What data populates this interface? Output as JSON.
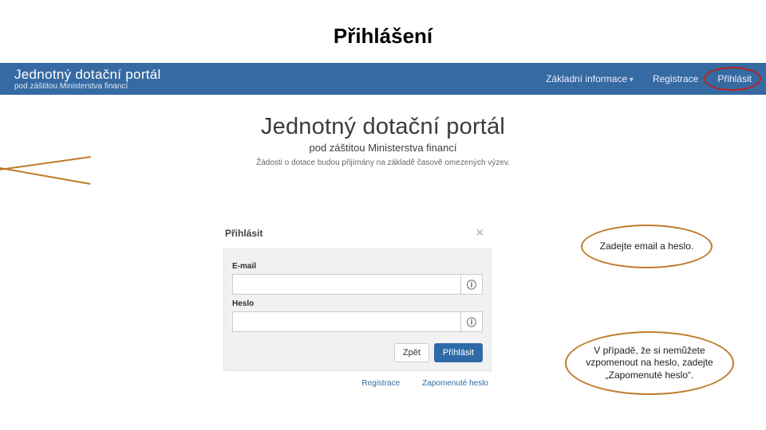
{
  "slide": {
    "title": "Přihlášení"
  },
  "nav": {
    "brand_main": "Jednotný dotační portál",
    "brand_sub": "pod záštitou Ministerstva financí",
    "item_info": "Základní informace",
    "item_register": "Registrace",
    "item_login": "Přihlásit"
  },
  "page_header": {
    "main": "Jednotný dotační portál",
    "sub": "pod záštitou Ministerstva financí",
    "sub2": "Žádosti o dotace budou přijímány na základě časově omezených výzev."
  },
  "modal": {
    "title": "Přihlásit",
    "label_email": "E-mail",
    "email_value": "",
    "label_password": "Heslo",
    "password_value": "",
    "btn_back": "Zpět",
    "btn_login": "Přihlásit",
    "link_register": "Registrace",
    "link_forgot": "Zapomenuté heslo",
    "info_glyph": "ⓘ"
  },
  "bubbles": {
    "b1": "Zadejte email a heslo.",
    "b2": "V případě, že si nemůžete vzpomenout na heslo, zadejte „Zapomenuté heslo“."
  }
}
